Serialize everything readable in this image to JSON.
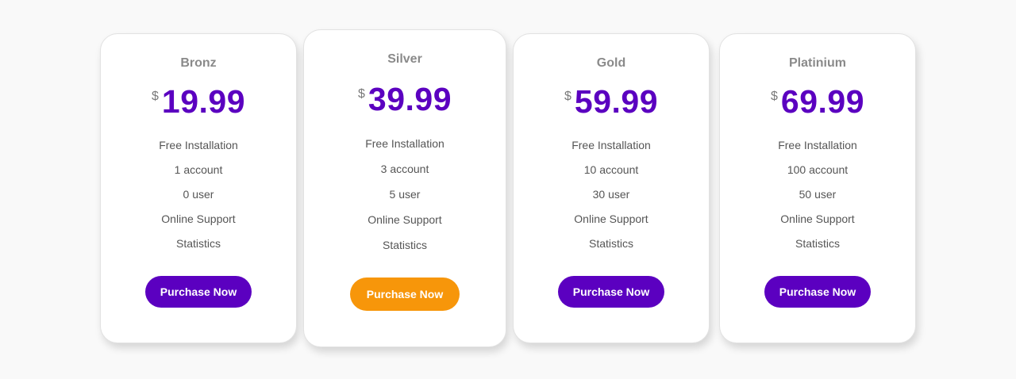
{
  "plans": [
    {
      "name": "Bronz",
      "currency": "$",
      "price": "19.99",
      "features": [
        "Free Installation",
        "1 account",
        "0 user",
        "Online Support",
        "Statistics"
      ],
      "button_label": "Purchase Now",
      "button_color": "#5b00c0"
    },
    {
      "name": "Silver",
      "currency": "$",
      "price": "39.99",
      "features": [
        "Free Installation",
        "3 account",
        "5 user",
        "Online Support",
        "Statistics"
      ],
      "button_label": "Purchase Now",
      "button_color": "#f7960a",
      "highlighted": true
    },
    {
      "name": "Gold",
      "currency": "$",
      "price": "59.99",
      "features": [
        "Free Installation",
        "10 account",
        "30 user",
        "Online Support",
        "Statistics"
      ],
      "button_label": "Purchase Now",
      "button_color": "#5b00c0"
    },
    {
      "name": "Platinium",
      "currency": "$",
      "price": "69.99",
      "features": [
        "Free Installation",
        "100 account",
        "50 user",
        "Online Support",
        "Statistics"
      ],
      "button_label": "Purchase Now",
      "button_color": "#5b00c0"
    }
  ],
  "colors": {
    "accent": "#5b00c0",
    "highlight": "#f7960a",
    "background": "#f9f9f9"
  }
}
